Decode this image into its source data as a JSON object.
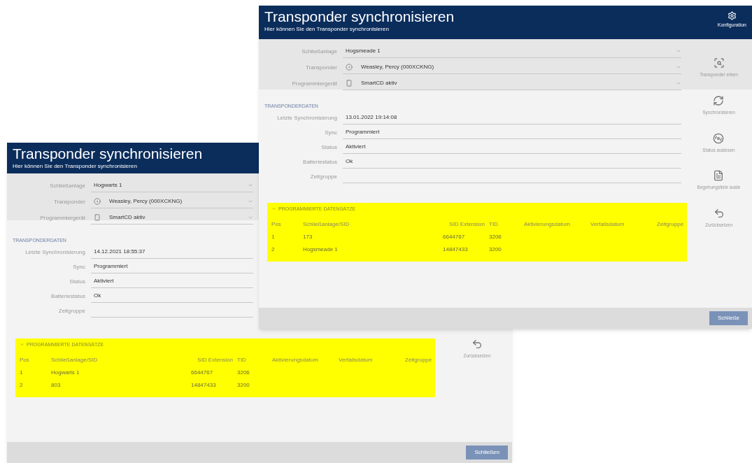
{
  "windows": [
    {
      "title": "Transponder synchronisieren",
      "subtitle": "Hier können Sie den Transponder synchronisieren",
      "selects": [
        {
          "label": "Schließanlage",
          "value": "Hogwarts 1",
          "kind": "plain"
        },
        {
          "label": "Transponder",
          "value": "Weasley, Percy (000XCKNG)",
          "kind": "transponder"
        },
        {
          "label": "Programmiergerät",
          "value": "SmartCD aktiv",
          "kind": "device"
        }
      ],
      "section_title": "TRANSPONDERDATEN",
      "fields": [
        {
          "label": "Letzte Synchronisierung",
          "value": "14.12.2021 18:55:37"
        },
        {
          "label": "Sync",
          "value": "Programmiert"
        },
        {
          "label": "Status",
          "value": "Aktiviert"
        },
        {
          "label": "Batteriestatus",
          "value": "Ok"
        },
        {
          "label": "Zeitgruppe"
        }
      ],
      "table": {
        "title": "PROGRAMMIERTE DATENSÄTZE",
        "columns": [
          "Pos",
          "Schließanlage/SID",
          "SID Extension",
          "TID",
          "Aktivierungsdatum",
          "Verfallsdatum",
          "Zeitgruppe"
        ],
        "rows": [
          [
            "1",
            "Hogwarts 1",
            "6644767",
            "3206",
            null,
            null,
            null
          ],
          [
            "2",
            "803",
            "14847433",
            "3200",
            null,
            null,
            null
          ]
        ]
      },
      "sidebar": [
        {
          "label": "Zurücksetzen",
          "kind": "reset"
        }
      ],
      "close_button": "Schließen"
    },
    {
      "title": "Transponder synchronisieren",
      "subtitle": "Hier können Sie den Transponder synchronisieren",
      "config": "Konfiguration",
      "selects": [
        {
          "label": "Schließanlage",
          "value": "Hogsmeade 1",
          "kind": "plain"
        },
        {
          "label": "Transponder",
          "value": "Weasley, Percy (000XCKNG)",
          "kind": "transponder"
        },
        {
          "label": "Programmiergerät",
          "value": "SmartCD aktiv",
          "kind": "device"
        }
      ],
      "section_title": "TRANSPONDERDATEN",
      "fields": [
        {
          "label": "Letzte Synchronisierung",
          "value": "13.01.2022 19:14:08"
        },
        {
          "label": "Sync",
          "value": "Programmiert"
        },
        {
          "label": "Status",
          "value": "Aktiviert"
        },
        {
          "label": "Batteriestatus",
          "value": "Ok"
        },
        {
          "label": "Zeitgruppe"
        }
      ],
      "table": {
        "title": "PROGRAMMIERTE DATENSÄTZE",
        "columns": [
          "Pos",
          "Schließanlage/SID",
          "SID Extension",
          "TID",
          "Aktivierungsdatum",
          "Verfallsdatum",
          "Zeitgruppe"
        ],
        "rows": [
          [
            "1",
            "173",
            "6644767",
            "3206",
            null,
            null,
            null
          ],
          [
            "2",
            "Hogsmeade 1",
            "14847433",
            "3200",
            null,
            null,
            null
          ]
        ]
      },
      "sidebar": [
        {
          "label": "Transponder erken",
          "kind": "detect"
        },
        {
          "label": "Synchronisieren",
          "kind": "sync"
        },
        {
          "label": "Status auslesen",
          "kind": "status"
        },
        {
          "label": "Begehungsliste ausle",
          "kind": "list"
        },
        {
          "label": "Zurücksetzen",
          "kind": "reset"
        }
      ],
      "close_button": "Schließe"
    }
  ]
}
